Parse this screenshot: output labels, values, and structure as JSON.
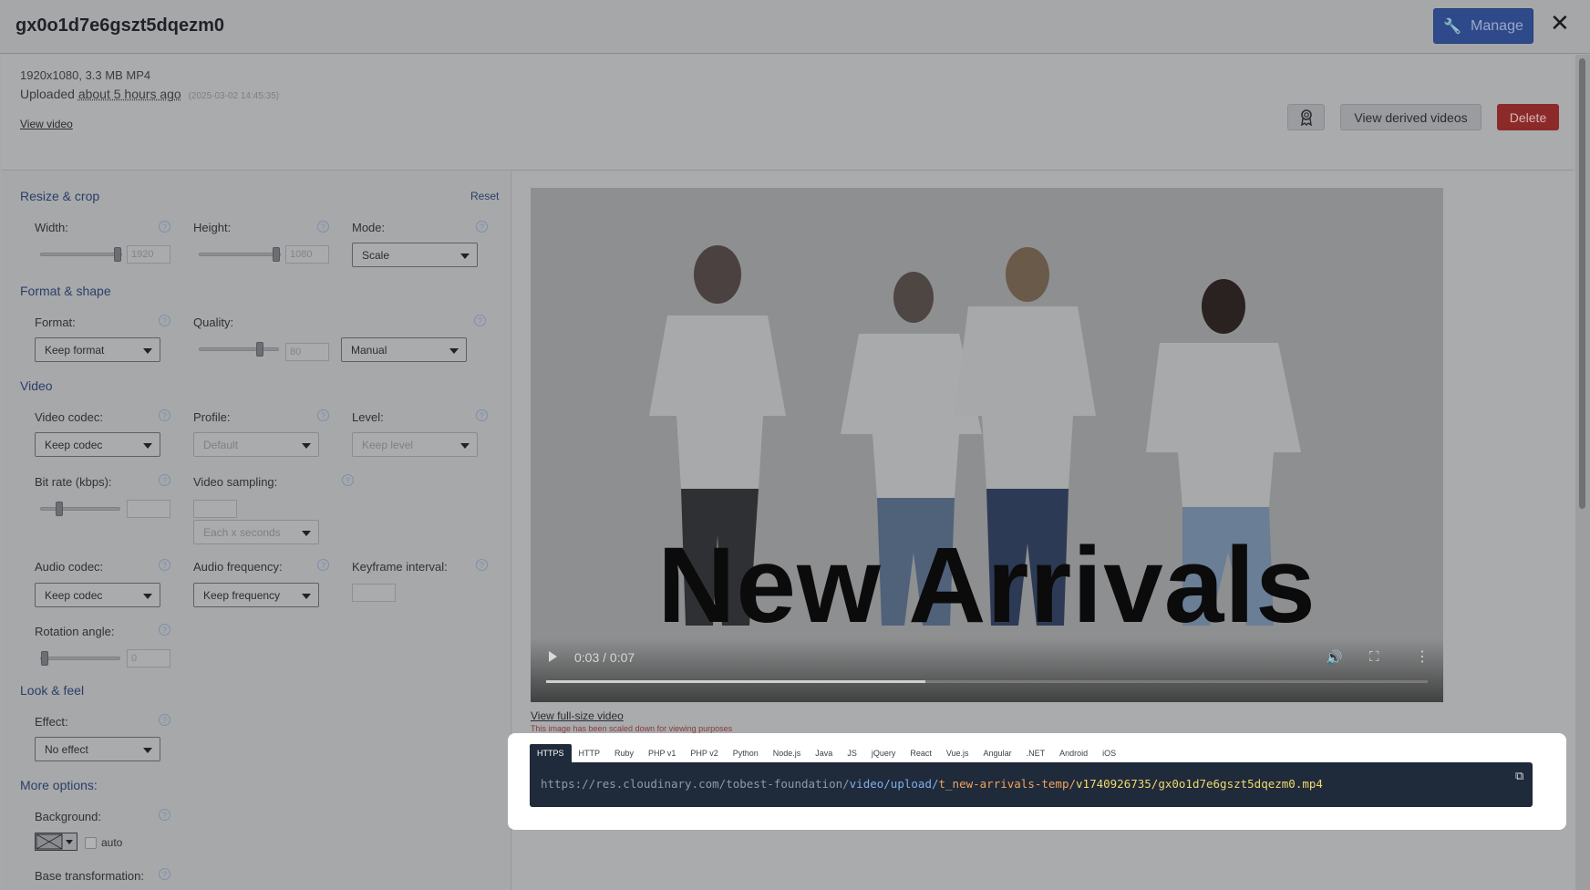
{
  "header": {
    "title": "gx0o1d7e6gszt5dqezm0",
    "manage_label": "Manage"
  },
  "info": {
    "dimensions": "1920x1080, 3.3 MB MP4",
    "uploaded_prefix": "Uploaded",
    "uploaded_ago": "about 5 hours ago",
    "uploaded_stamp": "(2025-03-02 14:45:35)",
    "view_video": "View video",
    "view_derived": "View derived videos",
    "delete": "Delete"
  },
  "left": {
    "resize_crop": "Resize & crop",
    "reset": "Reset",
    "width_label": "Width:",
    "width_value": "1920",
    "height_label": "Height:",
    "height_value": "1080",
    "mode_label": "Mode:",
    "mode_value": "Scale",
    "format_shape": "Format & shape",
    "format_label": "Format:",
    "format_value": "Keep format",
    "quality_label": "Quality:",
    "quality_value": "80",
    "quality_mode": "Manual",
    "video_section": "Video",
    "video_codec_label": "Video codec:",
    "video_codec_value": "Keep codec",
    "profile_label": "Profile:",
    "profile_value": "Default",
    "level_label": "Level:",
    "level_value": "Keep level",
    "bitrate_label": "Bit rate (kbps):",
    "sampling_label": "Video sampling:",
    "sampling_unit": "Each x seconds",
    "audio_codec_label": "Audio codec:",
    "audio_codec_value": "Keep codec",
    "audio_freq_label": "Audio frequency:",
    "audio_freq_value": "Keep frequency",
    "keyframe_label": "Keyframe interval:",
    "rotation_label": "Rotation angle:",
    "rotation_value": "0",
    "look_feel": "Look & feel",
    "effect_label": "Effect:",
    "effect_value": "No effect",
    "more_options": "More options:",
    "background_label": "Background:",
    "auto_label": "auto",
    "base_transformation_label": "Base transformation:"
  },
  "sliders": {
    "width": 1.0,
    "height": 1.0,
    "quality": 0.8,
    "bitrate": 0.2,
    "rotation": 0.0
  },
  "player": {
    "overlay_text": "New Arrivals",
    "time": "0:03 / 0:07",
    "progress": 0.43,
    "view_full_size": "View full-size video",
    "scaled_note": "This image has been scaled down for viewing purposes"
  },
  "url_box": {
    "tabs": [
      "HTTPS",
      "HTTP",
      "Ruby",
      "PHP v1",
      "PHP v2",
      "Python",
      "Node.js",
      "Java",
      "JS",
      "jQuery",
      "React",
      "Vue.js",
      "Angular",
      ".NET",
      "Android",
      "iOS"
    ],
    "active_tab": "HTTPS",
    "url_part1": "https://res.cloudinary.com/tobest-foundation/",
    "url_part2": "video/upload/",
    "url_part3": "t_new-arrivals-temp/",
    "url_part4": "v1740926735/gx0o1d7e6gszt5dqezm0.mp4"
  },
  "colors": {
    "manage": "#2f4a8a",
    "delete": "#8c2a2a",
    "code_bg": "#1f2a3b",
    "section_text": "#2b3f66"
  }
}
